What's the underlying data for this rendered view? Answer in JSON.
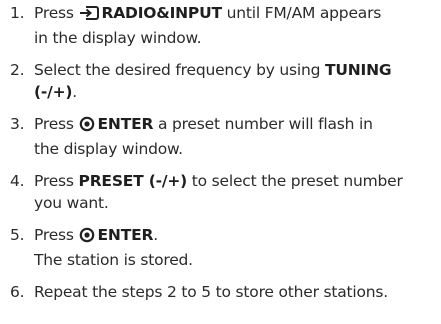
{
  "steps": [
    {
      "number": "1.",
      "icon": "input-arrow-icon",
      "line1_bold": "RADIO&INPUT",
      "line1_pre": "Press",
      "line1_post": "until FM/AM appears",
      "line2": "in the display window."
    },
    {
      "number": "2.",
      "line1_pre": "Select the desired frequency by using",
      "line1_bold": "TUNING",
      "line2_bold": "(-/+)",
      "line2_post": "."
    },
    {
      "number": "3.",
      "icon": "enter-circle-icon",
      "line1_pre": "Press",
      "line1_bold": "ENTER",
      "line1_post": "a preset number will flash in",
      "line2": "the display window."
    },
    {
      "number": "4.",
      "line1_pre": "Press",
      "line1_bold": "PRESET (-/+)",
      "line1_post": "to select the preset number",
      "line2": "you want."
    },
    {
      "number": "5.",
      "icon": "enter-circle-icon",
      "line1_pre": "Press",
      "line1_bold": "ENTER",
      "line1_post": ".",
      "line2": "The station is stored."
    },
    {
      "number": "6.",
      "line1_pre": "Repeat the steps 2 to 5 to store other stations."
    }
  ]
}
